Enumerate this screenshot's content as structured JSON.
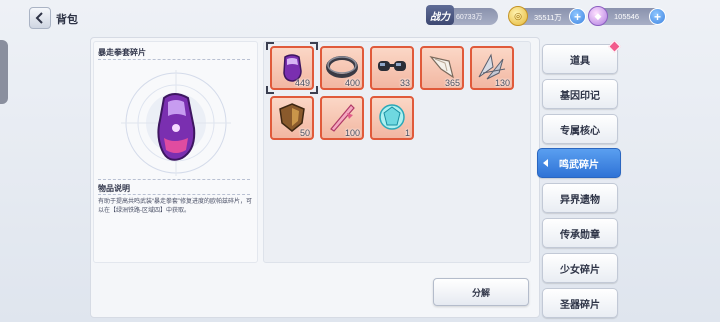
{
  "header": {
    "title": "背包",
    "power_label": "战力",
    "power_value": "60733万",
    "coins": "35511万",
    "gems": "105546"
  },
  "detail": {
    "item_name": "暴走拳套碎片",
    "section_label": "物品说明",
    "description": "有助于提高共鸣武装“暴走拳套”修复进度的欧帕兹碎片，可以在【绿洲铁路-区域四】中获取。"
  },
  "items": [
    {
      "icon": "purple-gauntlet-icon",
      "count": "449",
      "selected": true
    },
    {
      "icon": "dark-ring-icon",
      "count": "400"
    },
    {
      "icon": "goggles-icon",
      "count": "33"
    },
    {
      "icon": "white-claw-icon",
      "count": "365"
    },
    {
      "icon": "feather-wings-icon",
      "count": "130"
    },
    {
      "icon": "bronze-shield-icon",
      "count": "50"
    },
    {
      "icon": "pink-blade-icon",
      "count": "100"
    },
    {
      "icon": "cyan-crystal-icon",
      "count": "1"
    }
  ],
  "actions": {
    "decompose_label": "分解"
  },
  "tabs": [
    {
      "label": "道具"
    },
    {
      "label": "基因印记"
    },
    {
      "label": "专属核心"
    },
    {
      "label": "鸣武碎片"
    },
    {
      "label": "异界遗物"
    },
    {
      "label": "传承勋章"
    },
    {
      "label": "少女碎片"
    },
    {
      "label": "圣器碎片"
    }
  ],
  "colors": {
    "accent": "#2f73d6",
    "rarity_frame": "#e05a3a",
    "notification": "#f25c8c"
  }
}
